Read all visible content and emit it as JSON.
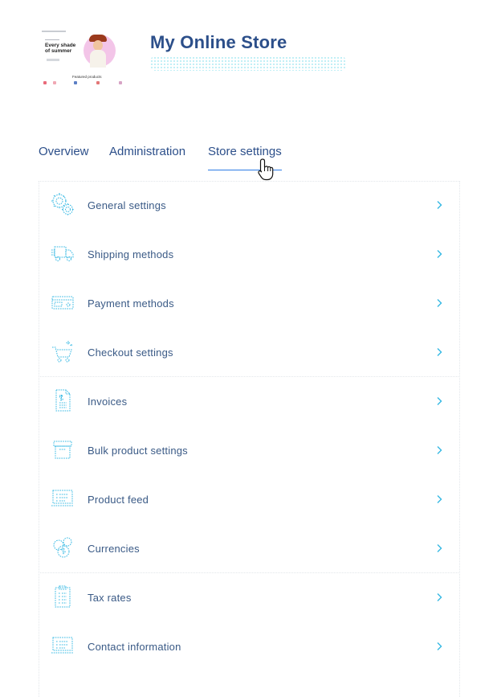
{
  "store": {
    "name": "My Online Store",
    "thumbnail": {
      "headline": "Every shade of summer",
      "featured": "Featured products"
    }
  },
  "tabs": [
    {
      "label": "Overview"
    },
    {
      "label": "Administration"
    },
    {
      "label": "Store settings",
      "active": true
    }
  ],
  "settings": [
    {
      "label": "General settings",
      "icon": "gears-icon"
    },
    {
      "label": "Shipping methods",
      "icon": "truck-icon"
    },
    {
      "label": "Payment methods",
      "icon": "credit-card-icon"
    },
    {
      "label": "Checkout settings",
      "icon": "cart-icon"
    },
    {
      "label": "Invoices",
      "icon": "invoice-icon"
    },
    {
      "label": "Bulk product settings",
      "icon": "box-icon"
    },
    {
      "label": "Product feed",
      "icon": "laptop-list-icon"
    },
    {
      "label": "Currencies",
      "icon": "coins-icon"
    },
    {
      "label": "Tax rates",
      "icon": "clipboard-icon"
    },
    {
      "label": "Contact information",
      "icon": "laptop-contact-icon"
    }
  ],
  "colors": {
    "accent": "#35b8e3",
    "title": "#2c4f8a",
    "active_tab_underline": "#2c7be5"
  }
}
